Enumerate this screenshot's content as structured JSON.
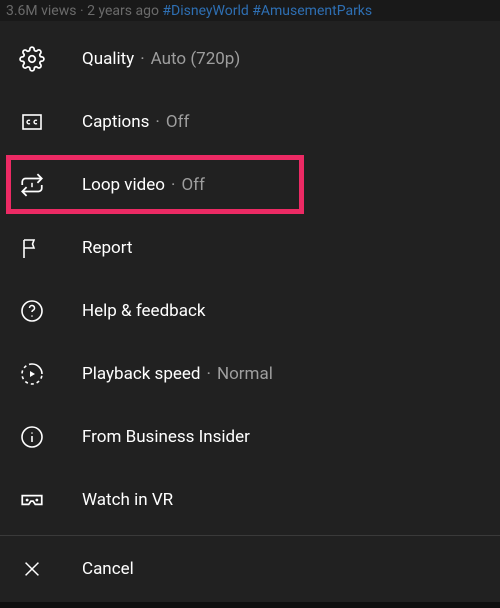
{
  "meta": {
    "views": "3.6M views",
    "age": "2 years ago",
    "hashtag1": "#DisneyWorld",
    "hashtag2": "#AmusementParks"
  },
  "menu": {
    "quality": {
      "label": "Quality",
      "value": "Auto (720p)"
    },
    "captions": {
      "label": "Captions",
      "value": "Off"
    },
    "loop": {
      "label": "Loop video",
      "value": "Off"
    },
    "report": {
      "label": "Report"
    },
    "help": {
      "label": "Help & feedback"
    },
    "speed": {
      "label": "Playback speed",
      "value": "Normal"
    },
    "from": {
      "label": "From Business Insider"
    },
    "vr": {
      "label": "Watch in VR"
    },
    "cancel": {
      "label": "Cancel"
    }
  }
}
